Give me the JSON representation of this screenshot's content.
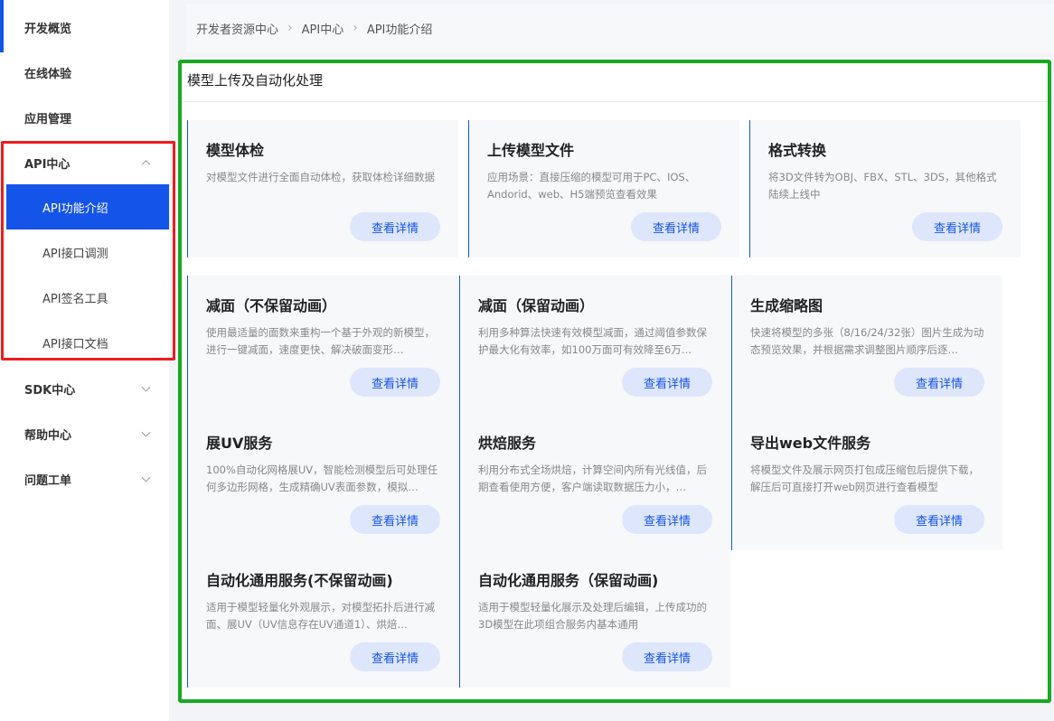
{
  "sidebar": {
    "items": [
      {
        "label": "开发概览"
      },
      {
        "label": "在线体验"
      },
      {
        "label": "应用管理"
      },
      {
        "label": "API中心"
      },
      {
        "label": "SDK中心"
      },
      {
        "label": "帮助中心"
      },
      {
        "label": "问题工单"
      }
    ],
    "api_sub": [
      {
        "label": "API功能介绍"
      },
      {
        "label": "API接口调测"
      },
      {
        "label": "API签名工具"
      },
      {
        "label": "API接口文档"
      }
    ]
  },
  "breadcrumb": [
    "开发者资源中心",
    "API中心",
    "API功能介绍"
  ],
  "section_title": "模型上传及自动化处理",
  "button_label": "查看详情",
  "cards": [
    {
      "title": "模型体检",
      "desc": "对模型文件进行全面自动体检，获取体检详细数据"
    },
    {
      "title": "上传模型文件",
      "desc": "应用场景：直接压缩的模型可用于PC、IOS、Andorid、web、H5端预览查看效果"
    },
    {
      "title": "格式转换",
      "desc": "将3D文件转为OBJ、FBX、STL、3DS，其他格式陆续上线中"
    },
    {
      "title": "减面（不保留动画）",
      "desc": "使用最适量的面数来重构一个基于外观的新模型，进行一键减面，速度更快、解决破面变形…"
    },
    {
      "title": "减面（保留动画）",
      "desc": "利用多种算法快速有效模型减面，通过阈值参数保护最大化有效率，如100万面可有效降至6万…"
    },
    {
      "title": "生成缩略图",
      "desc": "快速将模型的多张（8/16/24/32张）图片生成为动态预览效果，并根据需求调整图片顺序后逐…"
    },
    {
      "title": "展UV服务",
      "desc": "100%自动化网格展UV，智能检测模型后可处理任何多边形网格，生成精确UV表面参数，模拟…"
    },
    {
      "title": "烘焙服务",
      "desc": "利用分布式全场烘焙，计算空间内所有光线值，后期查看使用方便，客户端读取数据压力小，…"
    },
    {
      "title": "导出web文件服务",
      "desc": "将模型文件及展示网页打包成压缩包后提供下载，解压后可直接打开web网页进行查看模型"
    },
    {
      "title": "自动化通用服务(不保留动画)",
      "desc": "适用于模型轻量化外观展示，对模型拓扑后进行减面、展UV（UV信息存在UV通道1）、烘焙…"
    },
    {
      "title": "自动化通用服务（保留动画)",
      "desc": "适用于模型轻量化展示及处理后编辑，上传成功的3D模型在此项组合服务内基本通用"
    }
  ],
  "colors": {
    "accent": "#1554e8",
    "highlight_red": "#ee1c1c",
    "highlight_green": "#19a821"
  }
}
